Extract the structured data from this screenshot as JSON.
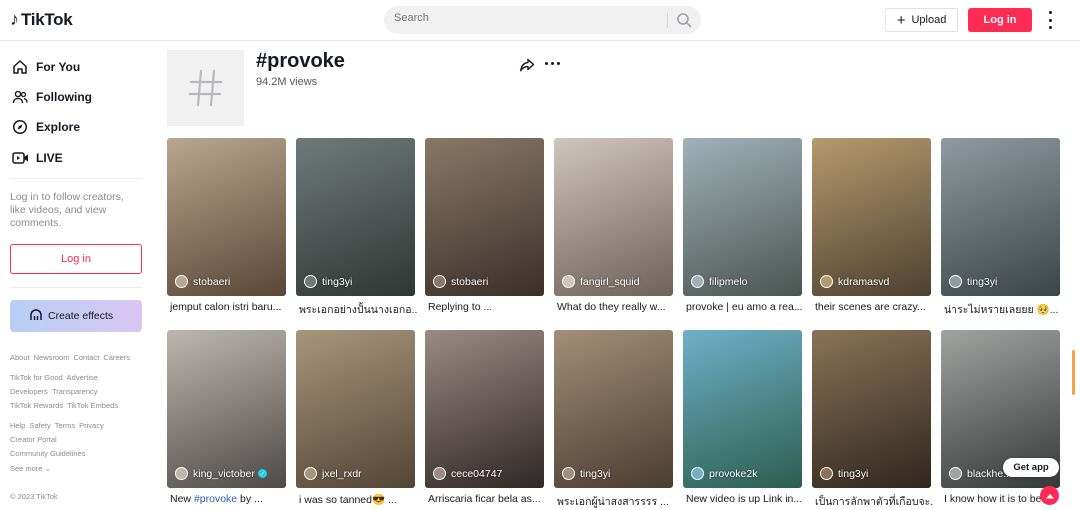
{
  "header": {
    "logo_text": "TikTok",
    "search_placeholder": "Search",
    "upload_label": "Upload",
    "login_label": "Log in"
  },
  "sidebar": {
    "nav": [
      {
        "label": "For You",
        "icon": "home-icon"
      },
      {
        "label": "Following",
        "icon": "users-icon"
      },
      {
        "label": "Explore",
        "icon": "compass-icon"
      },
      {
        "label": "LIVE",
        "icon": "live-icon"
      }
    ],
    "login_prompt": "Log in to follow creators, like videos, and view comments.",
    "login_button": "Log in",
    "create_effects": "Create effects",
    "footer_rows": [
      [
        "About",
        "Newsroom",
        "Contact",
        "Careers"
      ],
      [
        "TikTok for Good",
        "Advertise"
      ],
      [
        "Developers",
        "Transparency"
      ],
      [
        "TikTok Rewards",
        "TikTok Embeds"
      ],
      [
        "Help",
        "Safety",
        "Terms",
        "Privacy"
      ],
      [
        "Creator Portal"
      ],
      [
        "Community Guidelines"
      ],
      [
        "See more ⌄"
      ]
    ],
    "copyright": "© 2023 TikTok"
  },
  "tag": {
    "title": "#provoke",
    "views": "94.2M views"
  },
  "videos": [
    {
      "user": "stobaeri",
      "caption": "jemput calon istri baru...",
      "c1": "#b9a78f",
      "c2": "#5a4636"
    },
    {
      "user": "ting3yi",
      "caption": "พระเอกอย่างปั้นนางเอกอ...",
      "c1": "#6f7a78",
      "c2": "#2f3634"
    },
    {
      "user": "stobaeri",
      "caption": "Replying to ...",
      "c1": "#8a7866",
      "c2": "#3a2f28"
    },
    {
      "user": "fangirl_squid",
      "caption": "What do they really w...",
      "c1": "#cfc6bd",
      "c2": "#6e625a"
    },
    {
      "user": "filipmelo",
      "caption": "provoke | eu amo a rea...",
      "c1": "#9fb2b8",
      "c2": "#4b5551"
    },
    {
      "user": "kdramasvd",
      "caption": "their scenes are crazy...",
      "c1": "#b59a6d",
      "c2": "#4e4030"
    },
    {
      "user": "ting3yi",
      "caption": "น่าระไม่หรายเลยยย 🥺...",
      "c1": "#8f9ba0",
      "c2": "#3b4448"
    },
    {
      "user": "king_victober",
      "caption_pre": "New ",
      "caption_tag": "#provoke",
      "caption_post": " by ...",
      "verified": true,
      "c1": "#bdb7b0",
      "c2": "#4e4a48"
    },
    {
      "user": "jxel_rxdr",
      "caption": "i was so tanned😎 ...",
      "c1": "#a8957c",
      "c2": "#534535"
    },
    {
      "user": "cece04747",
      "caption": "Arriscaria ficar bela as...",
      "c1": "#9a8b84",
      "c2": "#2f2727"
    },
    {
      "user": "ting3yi",
      "caption": "พระเอกผู้น่าสงสารรรร ...",
      "c1": "#a38f79",
      "c2": "#4a3c2f"
    },
    {
      "user": "provoke2k",
      "caption": "New video is up Link in...",
      "c1": "#6fb0c8",
      "c2": "#2c5e4e"
    },
    {
      "user": "ting3yi",
      "caption": "เป็นการลักพาตัวที่เกือบจะ...",
      "c1": "#8a7358",
      "c2": "#2f261d"
    },
    {
      "user": "blackhe...",
      "caption": "I know how it is to be...",
      "c1": "#a0a4a1",
      "c2": "#373838"
    }
  ],
  "get_app": "Get app",
  "colors": {
    "brand": "#fe2c55",
    "hashtag_link": "#2b5db9",
    "verified": "#20d5ec"
  }
}
